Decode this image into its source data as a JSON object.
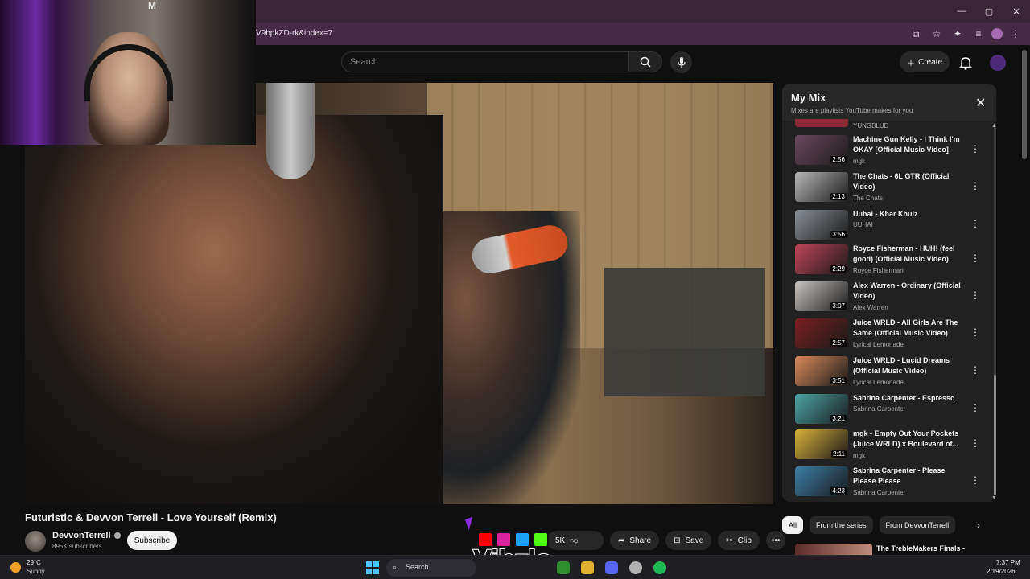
{
  "browser": {
    "url": "V9bpkZD-rk&index=7",
    "window_controls": [
      "—",
      "▢",
      "✕"
    ],
    "address_icons": [
      "cast-icon",
      "star-icon",
      "extensions-icon",
      "media-icon",
      "profile-icon",
      "menu-icon"
    ]
  },
  "webcam_logo": "M",
  "header": {
    "search_placeholder": "Search",
    "create_label": "Create"
  },
  "video": {
    "title": "Futuristic & Devvon Terrell - Love Yourself (Remix)",
    "channel_name": "DevvonTerrell",
    "subscribers": "895K subscribers",
    "subscribe_label": "Subscribe",
    "like_count": "5K",
    "actions": {
      "share": "Share",
      "save": "Save",
      "clip": "Clip"
    }
  },
  "overlay": {
    "brand": "Vibzlo",
    "social_colors": [
      "#ff0000",
      "#d6249f",
      "#1da1f2",
      "#53fc18"
    ]
  },
  "mix": {
    "title": "My Mix",
    "subtitle": "Mixes are playlists YouTube makes for you",
    "previous_artist": "YUNGBLUD",
    "items": [
      {
        "title": "Machine Gun Kelly - I Think I'm OKAY [Official Music Video]",
        "artist": "mgk",
        "duration": "2:56",
        "color": "#6b4a5e"
      },
      {
        "title": "The Chats - 6L GTR (Official Video)",
        "artist": "The Chats",
        "duration": "2:13",
        "color": "#b8b8b8"
      },
      {
        "title": "Uuhai - Khar Khulz",
        "artist": "UUHAI",
        "duration": "3:56",
        "color": "#8a8f96"
      },
      {
        "title": "Royce Fisherman - HUH! (feel good) (Official Music Video)",
        "artist": "Royce Fisherman",
        "duration": "2:29",
        "color": "#c0445a"
      },
      {
        "title": "Alex Warren - Ordinary (Official Video)",
        "artist": "Alex Warren",
        "duration": "3:07",
        "color": "#c9c5c2"
      },
      {
        "title": "Juice WRLD - All Girls Are The Same (Official Music Video)",
        "artist": "Lyrical Lemonade",
        "duration": "2:57",
        "color": "#7a1f22"
      },
      {
        "title": "Juice WRLD - Lucid Dreams (Official Music Video)",
        "artist": "Lyrical Lemonade",
        "duration": "3:51",
        "color": "#d98a5a"
      },
      {
        "title": "Sabrina Carpenter - Espresso",
        "artist": "Sabrina Carpenter",
        "duration": "3:21",
        "color": "#4da6a6"
      },
      {
        "title": "mgk - Empty Out Your Pockets (Juice WRLD) x Boulevard of...",
        "artist": "mgk",
        "duration": "2:11",
        "color": "#d8b23a"
      },
      {
        "title": "Sabrina Carpenter - Please Please Please",
        "artist": "Sabrina Carpenter",
        "duration": "4:23",
        "color": "#3a7fa6"
      }
    ]
  },
  "chips": [
    "All",
    "From the series",
    "From DevvonTerrell"
  ],
  "next_card_title": "The TrebleMakers Finals -",
  "taskbar": {
    "temp": "29°C",
    "weather": "Sunny",
    "search_label": "Search",
    "time": "7:37 PM",
    "date": "2/19/2026",
    "apps": [
      "#2f8f2f",
      "#e0b030",
      "#5865f2",
      "#b0b0b0",
      "#1db954"
    ]
  }
}
